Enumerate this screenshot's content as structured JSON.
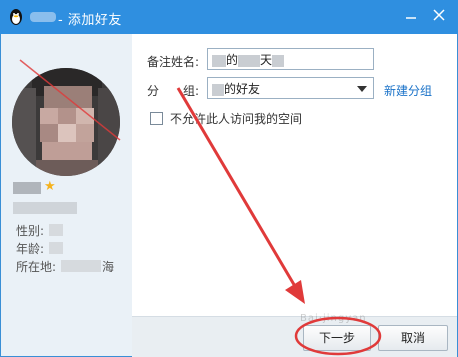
{
  "window": {
    "title": "- 添加好友",
    "minimize_icon": "minimize-icon",
    "close_icon": "close-icon"
  },
  "profile": {
    "info_labels": {
      "gender": "性别:",
      "age": "年龄:",
      "location": "所在地:"
    },
    "location_tail": "海"
  },
  "form": {
    "remark_label": "备注姓名:",
    "remark_prefix": "",
    "remark_mid": "的",
    "remark_suffix": "天",
    "group_label_1": "分",
    "group_label_2": "组:",
    "group_value": "的好友",
    "new_group_link": "新建分组",
    "checkbox_label": "不允许此人访问我的空间",
    "checkbox_checked": false
  },
  "footer": {
    "next_label": "下一步",
    "cancel_label": "取消"
  },
  "colors": {
    "titlebar": "#2f8fe0",
    "annotation": "#e03a3a",
    "link": "#1a72c8"
  }
}
